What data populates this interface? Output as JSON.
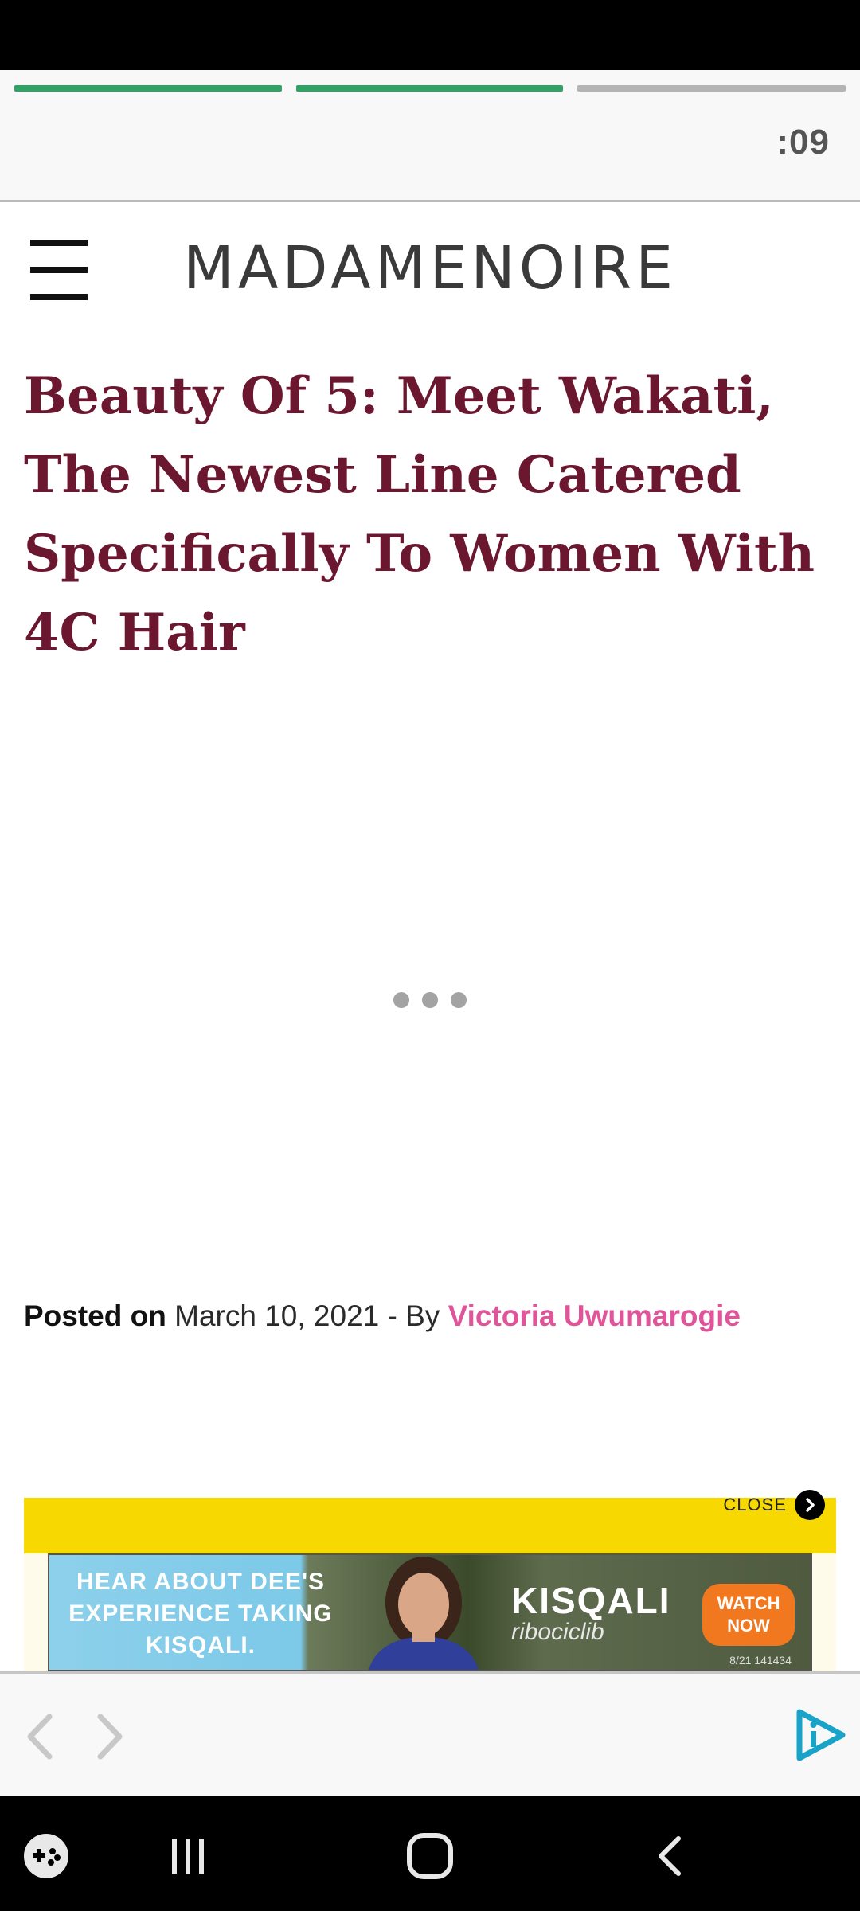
{
  "story": {
    "progress_colors": {
      "done": "#2fa366",
      "pending": "#b4b4b4"
    },
    "segments": [
      {
        "state": "complete"
      },
      {
        "state": "complete"
      },
      {
        "state": "pending"
      }
    ],
    "timer": ":09"
  },
  "site": {
    "logo": "MADAMENOIRE"
  },
  "article": {
    "headline": "Beauty Of 5: Meet Wakati, The Newest Line Catered Specifically To Women With 4C Hair",
    "byline": {
      "posted_label": "Posted on",
      "date_and_by": " March 10, 2021 - By ",
      "author": "Victoria Uwumarogie"
    }
  },
  "ad": {
    "close_label": "CLOSE",
    "text": "HEAR ABOUT DEE'S EXPERIENCE TAKING KISQALI.",
    "brand": "KISQALI",
    "brand_sub": "ribociclib",
    "cta": "WATCH NOW",
    "code": "8/21 141434"
  },
  "colors": {
    "headline": "#6b1730",
    "author_link": "#e0559a",
    "ad_yellow": "#f7d800",
    "brand_icon": "#1aa3c8"
  }
}
